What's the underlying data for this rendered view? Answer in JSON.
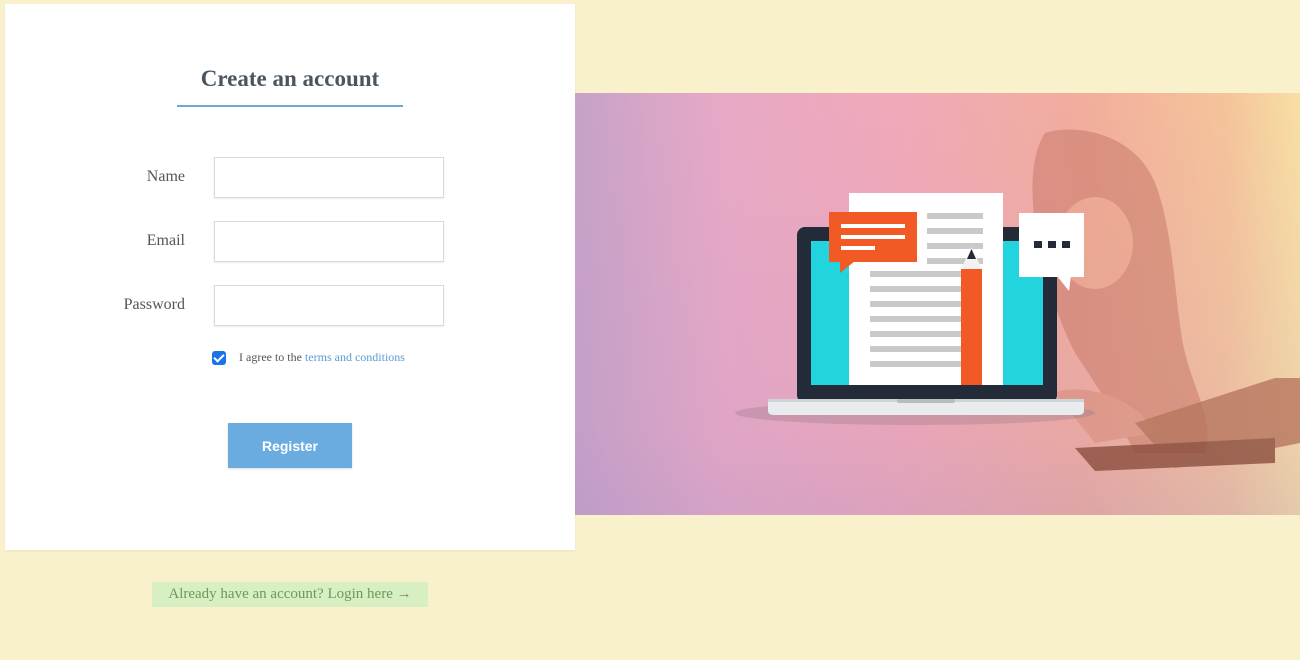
{
  "form": {
    "title": "Create an account",
    "fields": [
      {
        "label": "Name",
        "value": "",
        "placeholder": ""
      },
      {
        "label": "Email",
        "value": "",
        "placeholder": ""
      },
      {
        "label": "Password",
        "value": "",
        "placeholder": ""
      }
    ],
    "agree_text": "I agree to the",
    "terms_link": "terms and conditions",
    "agree_checked": true,
    "register_label": "Register"
  },
  "login_link": "Already have an account? Login here →",
  "hero": {
    "icons": [
      "laptop-illustration",
      "document-icon",
      "pencil-icon",
      "chat-bubble-icon",
      "ellipsis-bubble-icon"
    ]
  },
  "colors": {
    "background": "#f9f0cc",
    "accent": "#6aace0",
    "login_bg": "#d8efc4",
    "login_text": "#6a9a5a"
  }
}
